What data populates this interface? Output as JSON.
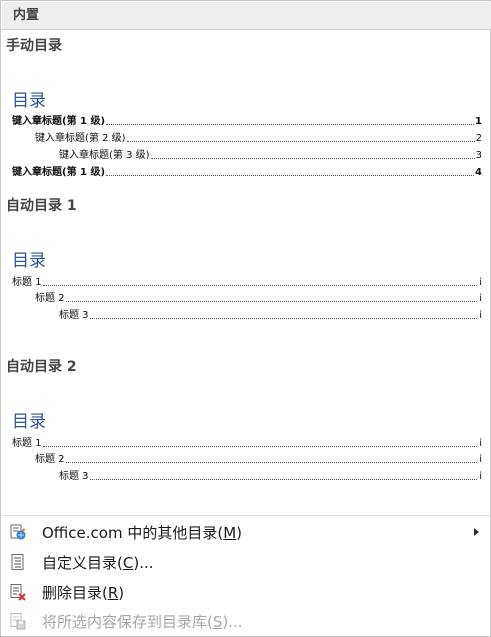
{
  "section_header": "内置",
  "items": [
    {
      "title": "手动目录",
      "toc_heading": "目录",
      "lines": [
        {
          "label": "键入章标题(第 1 级)",
          "page": "1"
        },
        {
          "label": "键入章标题(第 2 级)",
          "page": "2"
        },
        {
          "label": "键入章标题(第 3 级)",
          "page": "3"
        },
        {
          "label": "键入章标题(第 1 级)",
          "page": "4"
        }
      ]
    },
    {
      "title": "自动目录 1",
      "toc_heading": "目录",
      "lines": [
        {
          "label": "标题 1",
          "page": "i"
        },
        {
          "label": "标题 2",
          "page": "i"
        },
        {
          "label": "标题 3",
          "page": "i"
        }
      ]
    },
    {
      "title": "自动目录 2",
      "toc_heading": "目录",
      "lines": [
        {
          "label": "标题 1",
          "page": "i"
        },
        {
          "label": "标题 2",
          "page": "i"
        },
        {
          "label": "标题 3",
          "page": "i"
        }
      ]
    }
  ],
  "menu": {
    "more_toc": {
      "pre": "Office.com 中的其他目录(",
      "key": "M",
      "post": ")",
      "icon": "office-toc-icon"
    },
    "custom_toc": {
      "pre": "自定义目录(",
      "key": "C",
      "post": ")...",
      "icon": "custom-toc-icon"
    },
    "remove_toc": {
      "pre": "删除目录(",
      "key": "R",
      "post": ")",
      "icon": "remove-toc-icon"
    },
    "save_selection": {
      "pre": "将所选内容保存到目录库(",
      "key": "S",
      "post": ")...",
      "icon": "save-to-gallery-icon"
    }
  }
}
